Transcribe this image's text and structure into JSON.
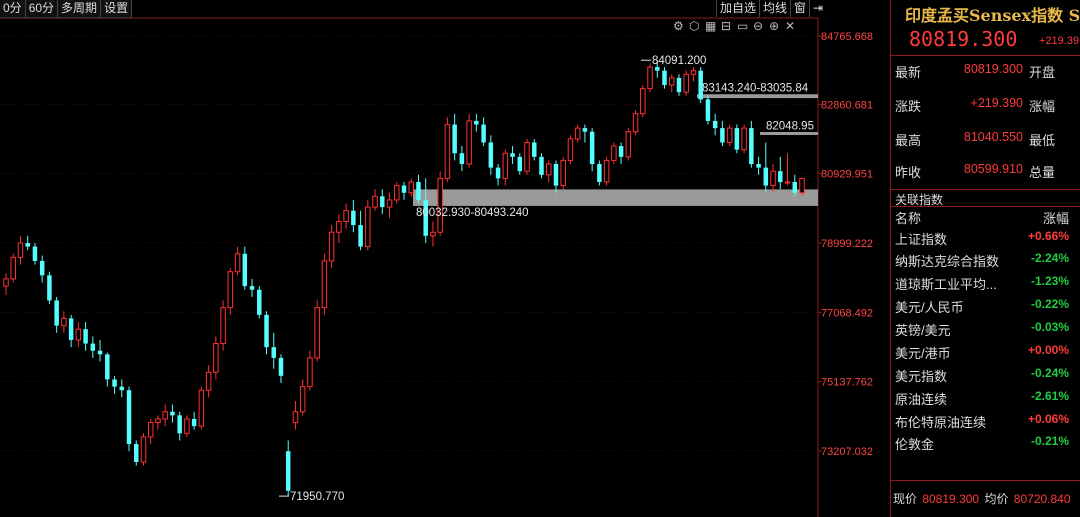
{
  "toolbar": {
    "periods": [
      "0分",
      "60分",
      "多周期",
      "设置"
    ],
    "right_buttons": [
      "加自选",
      "均线",
      "窗"
    ],
    "right_icons": [
      "back-arrow-icon"
    ]
  },
  "chart_icons": [
    "gear-icon",
    "hexagon-icon",
    "grid-icon",
    "scale-icon",
    "window-icon",
    "zoom-out-icon",
    "zoom-in-icon",
    "close-icon"
  ],
  "chart_data": {
    "type": "candlestick",
    "y_ticks": [
      "84765.668",
      "82860.681",
      "80929.951",
      "78999.222",
      "77068.492",
      "75137.762",
      "73207.032"
    ],
    "y_range": [
      72300,
      85600
    ],
    "annotations": {
      "high": "84091.200",
      "low": "71950.770",
      "zone_top": "83143.240-83035.84",
      "level_2": "82048.95",
      "zone_bottom": "80032.930-80493.240"
    },
    "zones": [
      {
        "low": 80032.93,
        "high": 80493.24
      },
      {
        "low": 83035.84,
        "high": 83143.24
      }
    ],
    "level": 82048.95,
    "candles": [
      [
        77800,
        78150,
        77550,
        78000
      ],
      [
        78000,
        78700,
        77900,
        78600
      ],
      [
        78600,
        79200,
        78400,
        79000
      ],
      [
        79000,
        79200,
        78800,
        78900
      ],
      [
        78900,
        79000,
        78400,
        78500
      ],
      [
        78500,
        78650,
        77900,
        78100
      ],
      [
        78100,
        78200,
        77300,
        77400
      ],
      [
        77400,
        77500,
        76500,
        76700
      ],
      [
        76700,
        77100,
        76500,
        76900
      ],
      [
        76900,
        77000,
        76100,
        76300
      ],
      [
        76300,
        76800,
        76100,
        76600
      ],
      [
        76600,
        76800,
        76000,
        76200
      ],
      [
        76200,
        76400,
        75800,
        76000
      ],
      [
        76000,
        76300,
        75700,
        75900
      ],
      [
        75900,
        75950,
        75000,
        75200
      ],
      [
        75200,
        75300,
        74800,
        75000
      ],
      [
        75000,
        75200,
        74700,
        74900
      ],
      [
        74900,
        75000,
        73200,
        73400
      ],
      [
        73400,
        73500,
        72800,
        72900
      ],
      [
        72900,
        73700,
        72800,
        73600
      ],
      [
        73600,
        74100,
        73400,
        74000
      ],
      [
        74000,
        74200,
        73800,
        74100
      ],
      [
        74100,
        74500,
        73900,
        74300
      ],
      [
        74300,
        74500,
        74000,
        74200
      ],
      [
        74200,
        74300,
        73500,
        73700
      ],
      [
        73700,
        74200,
        73600,
        74100
      ],
      [
        74100,
        74300,
        73800,
        73900
      ],
      [
        73900,
        75000,
        73800,
        74900
      ],
      [
        74900,
        75600,
        74700,
        75400
      ],
      [
        75400,
        76400,
        75200,
        76200
      ],
      [
        76200,
        77400,
        76000,
        77200
      ],
      [
        77200,
        78300,
        77000,
        78200
      ],
      [
        78200,
        78900,
        78100,
        78700
      ],
      [
        78700,
        78900,
        77700,
        77800
      ],
      [
        77800,
        78000,
        77500,
        77700
      ],
      [
        77700,
        77800,
        76900,
        77000
      ],
      [
        77000,
        77100,
        75900,
        76100
      ],
      [
        76100,
        76500,
        75500,
        75800
      ],
      [
        75800,
        75900,
        75100,
        75300
      ],
      [
        73200,
        73500,
        71950.77,
        72100
      ],
      [
        74000,
        74600,
        73800,
        74300
      ],
      [
        74300,
        75200,
        74200,
        75000
      ],
      [
        75000,
        76000,
        74900,
        75800
      ],
      [
        75800,
        77400,
        75700,
        77200
      ],
      [
        77200,
        78700,
        77000,
        78500
      ],
      [
        78500,
        79500,
        78300,
        79300
      ],
      [
        79300,
        79800,
        79000,
        79600
      ],
      [
        79600,
        80100,
        79400,
        79900
      ],
      [
        79900,
        80200,
        79300,
        79500
      ],
      [
        79500,
        79900,
        78800,
        78900
      ],
      [
        78900,
        80200,
        78800,
        80000
      ],
      [
        80000,
        80500,
        79900,
        80300
      ],
      [
        80300,
        80500,
        79800,
        80000
      ],
      [
        80000,
        80400,
        79700,
        80200
      ],
      [
        80200,
        80700,
        80100,
        80600
      ],
      [
        80600,
        80700,
        80200,
        80400
      ],
      [
        80400,
        80800,
        80300,
        80700
      ],
      [
        80700,
        80900,
        80100,
        80200
      ],
      [
        80200,
        80800,
        79000,
        79200
      ],
      [
        79200,
        79600,
        78900,
        79300
      ],
      [
        79300,
        81000,
        79200,
        80800
      ],
      [
        80800,
        82500,
        80700,
        82300
      ],
      [
        82300,
        82600,
        81300,
        81500
      ],
      [
        81500,
        81700,
        81000,
        81200
      ],
      [
        81200,
        82600,
        81100,
        82400
      ],
      [
        82400,
        82600,
        82100,
        82300
      ],
      [
        82300,
        82500,
        81700,
        81800
      ],
      [
        81800,
        82000,
        80900,
        81100
      ],
      [
        81100,
        81200,
        80600,
        80800
      ],
      [
        80800,
        81600,
        80600,
        81500
      ],
      [
        81500,
        81700,
        81200,
        81400
      ],
      [
        81400,
        81500,
        80900,
        81000
      ],
      [
        81000,
        81900,
        80900,
        81800
      ],
      [
        81800,
        81900,
        81300,
        81400
      ],
      [
        81400,
        81500,
        80800,
        80900
      ],
      [
        80900,
        81300,
        80700,
        81200
      ],
      [
        81200,
        81300,
        80400,
        80600
      ],
      [
        80600,
        81400,
        80500,
        81300
      ],
      [
        81300,
        82000,
        81200,
        81900
      ],
      [
        81900,
        82300,
        81800,
        82200
      ],
      [
        82200,
        82300,
        81800,
        82100
      ],
      [
        82100,
        82200,
        81000,
        81200
      ],
      [
        81200,
        81300,
        80600,
        80700
      ],
      [
        80700,
        81400,
        80600,
        81300
      ],
      [
        81300,
        81800,
        81200,
        81700
      ],
      [
        81700,
        81800,
        81200,
        81400
      ],
      [
        81400,
        82200,
        81300,
        82100
      ],
      [
        82100,
        82700,
        82000,
        82600
      ],
      [
        82600,
        83400,
        82500,
        83300
      ],
      [
        83300,
        84000,
        83200,
        83900
      ],
      [
        83900,
        84091.2,
        83600,
        83800
      ],
      [
        83800,
        83900,
        83300,
        83400
      ],
      [
        83400,
        83700,
        83200,
        83600
      ],
      [
        83600,
        83700,
        83100,
        83200
      ],
      [
        83200,
        83800,
        83100,
        83700
      ],
      [
        83700,
        83900,
        83500,
        83800
      ],
      [
        83800,
        83900,
        82900,
        83000
      ],
      [
        83000,
        83100,
        82300,
        82400
      ],
      [
        82400,
        82600,
        82000,
        82200
      ],
      [
        82200,
        82400,
        81700,
        81800
      ],
      [
        81800,
        82300,
        81700,
        82200
      ],
      [
        82200,
        82300,
        81500,
        81600
      ],
      [
        81600,
        82300,
        81500,
        82200
      ],
      [
        82200,
        82400,
        81100,
        81200
      ],
      [
        81200,
        81400,
        80900,
        81100
      ],
      [
        81100,
        81800,
        80400,
        80600
      ],
      [
        80600,
        81200,
        80400,
        81000
      ],
      [
        81000,
        81400,
        80500,
        80700
      ],
      [
        80700,
        81500,
        80600,
        80700
      ],
      [
        80700,
        80900,
        80300,
        80400
      ],
      [
        80400,
        80819.3,
        80300,
        80800
      ]
    ]
  },
  "quote": {
    "title": "印度孟买Sensex指数 S",
    "price": "80819.300",
    "change": "+219.39",
    "rows": [
      {
        "label": "最新",
        "value": "80819.300",
        "label2": "开盘"
      },
      {
        "label": "涨跌",
        "value": "+219.390",
        "label2": "涨幅"
      },
      {
        "label": "最高",
        "value": "81040.550",
        "label2": "最低"
      },
      {
        "label": "昨收",
        "value": "80599.910",
        "label2": "总量"
      }
    ]
  },
  "related": {
    "header": "关联指数",
    "col_name": "名称",
    "col_change": "涨幅",
    "items": [
      {
        "name": "上证指数",
        "change": "+0.66%",
        "dir": "up"
      },
      {
        "name": "纳斯达克综合指数",
        "change": "-2.24%",
        "dir": "dn"
      },
      {
        "name": "道琼斯工业平均...",
        "change": "-1.23%",
        "dir": "dn"
      },
      {
        "name": "美元/人民币",
        "change": "-0.22%",
        "dir": "dn"
      },
      {
        "name": "英镑/美元",
        "change": "-0.03%",
        "dir": "dn"
      },
      {
        "name": "美元/港币",
        "change": "+0.00%",
        "dir": "up"
      },
      {
        "name": "美元指数",
        "change": "-0.24%",
        "dir": "dn"
      },
      {
        "name": "原油连续",
        "change": "-2.61%",
        "dir": "dn"
      },
      {
        "name": "布伦特原油连续",
        "change": "+0.06%",
        "dir": "up"
      },
      {
        "name": "伦敦金",
        "change": "-0.21%",
        "dir": "dn"
      }
    ]
  },
  "footer": {
    "price_label": "现价",
    "price": "80819.300",
    "avg_label": "均价",
    "avg": "80720.840"
  }
}
